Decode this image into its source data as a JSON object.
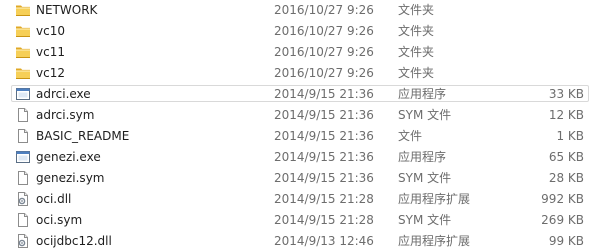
{
  "files": [
    {
      "name": "NETWORK",
      "date": "2016/10/27 9:26",
      "type": "文件夹",
      "size": "",
      "icon": "folder-icon"
    },
    {
      "name": "vc10",
      "date": "2016/10/27 9:26",
      "type": "文件夹",
      "size": "",
      "icon": "folder-icon"
    },
    {
      "name": "vc11",
      "date": "2016/10/27 9:26",
      "type": "文件夹",
      "size": "",
      "icon": "folder-icon"
    },
    {
      "name": "vc12",
      "date": "2016/10/27 9:26",
      "type": "文件夹",
      "size": "",
      "icon": "folder-icon"
    },
    {
      "name": "adrci.exe",
      "date": "2014/9/15 21:36",
      "type": "应用程序",
      "size": "33 KB",
      "icon": "exe-icon"
    },
    {
      "name": "adrci.sym",
      "date": "2014/9/15 21:36",
      "type": "SYM 文件",
      "size": "12 KB",
      "icon": "file-icon"
    },
    {
      "name": "BASIC_README",
      "date": "2014/9/15 21:36",
      "type": "文件",
      "size": "1 KB",
      "icon": "file-icon"
    },
    {
      "name": "genezi.exe",
      "date": "2014/9/15 21:36",
      "type": "应用程序",
      "size": "65 KB",
      "icon": "exe-icon"
    },
    {
      "name": "genezi.sym",
      "date": "2014/9/15 21:36",
      "type": "SYM 文件",
      "size": "28 KB",
      "icon": "file-icon"
    },
    {
      "name": "oci.dll",
      "date": "2014/9/15 21:28",
      "type": "应用程序扩展",
      "size": "992 KB",
      "icon": "dll-icon"
    },
    {
      "name": "oci.sym",
      "date": "2014/9/15 21:28",
      "type": "SYM 文件",
      "size": "269 KB",
      "icon": "file-icon"
    },
    {
      "name": "ocijdbc12.dll",
      "date": "2014/9/13 12:46",
      "type": "应用程序扩展",
      "size": "99 KB",
      "icon": "dll-icon"
    }
  ],
  "selected_index": 4
}
